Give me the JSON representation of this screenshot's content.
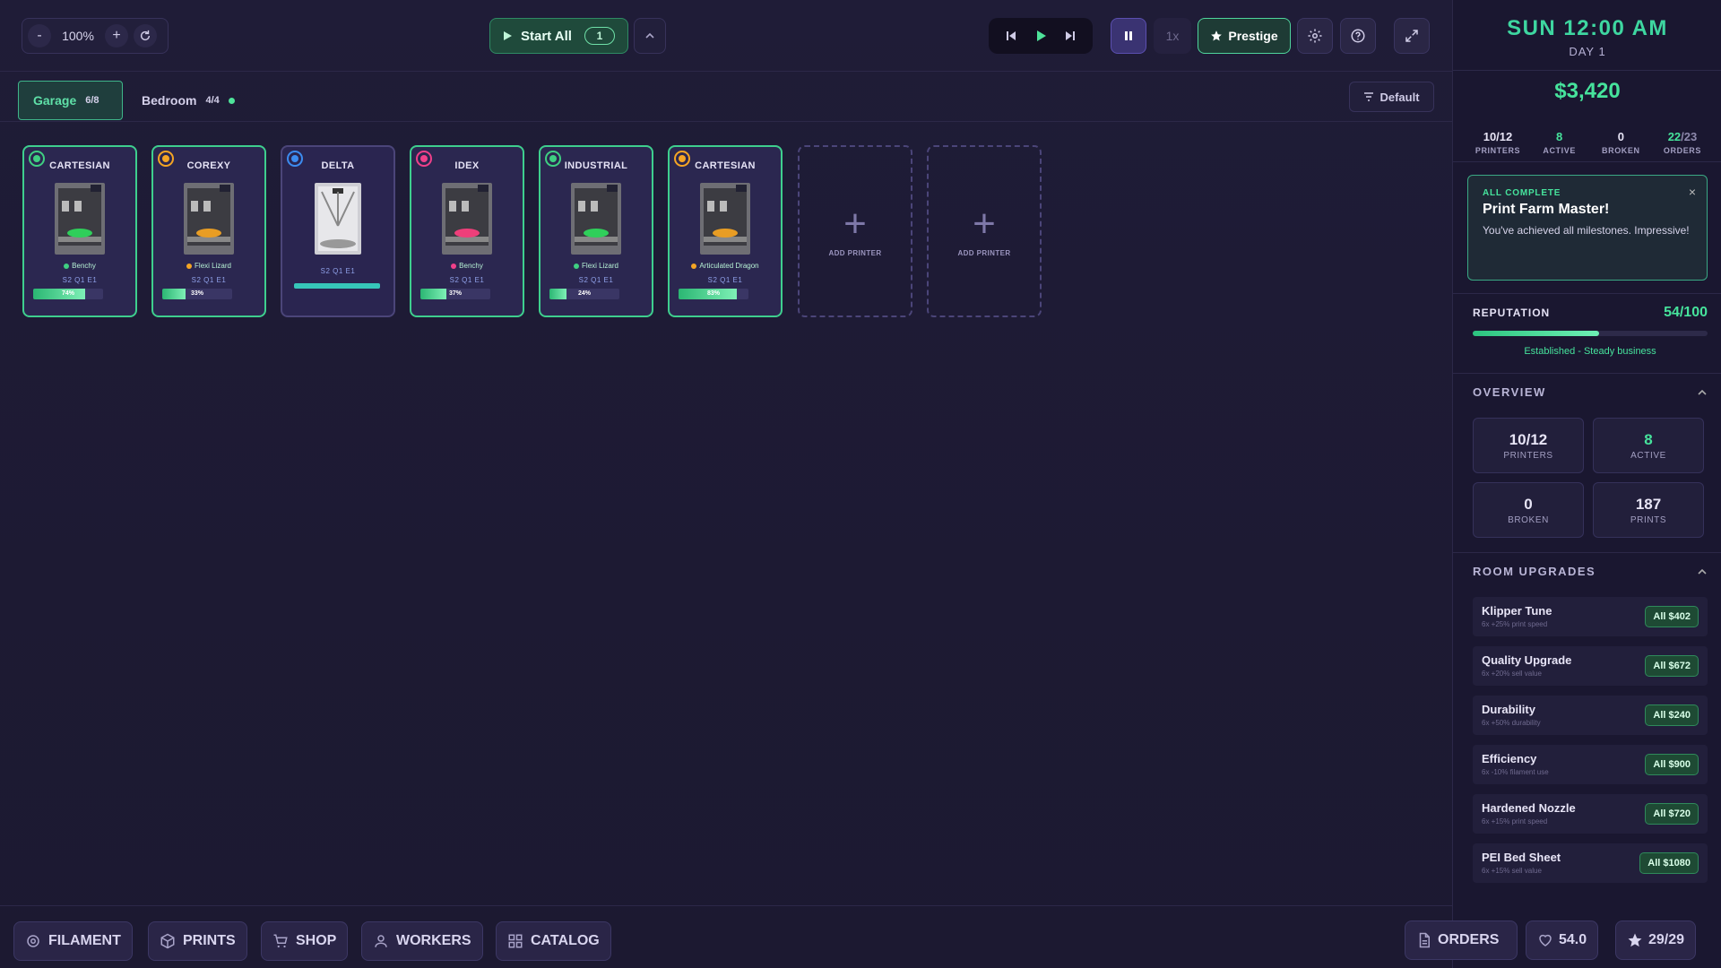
{
  "toolbar": {
    "zoom_minus": "-",
    "zoom_value": "100%",
    "zoom_plus": "+",
    "start_all_label": "Start All",
    "start_all_count": "1",
    "speed_label": "1x",
    "prestige_label": "Prestige"
  },
  "rooms": [
    {
      "name": "Garage",
      "count": "6/8"
    },
    {
      "name": "Bedroom",
      "count": "4/4"
    }
  ],
  "sort_label": "Default",
  "printers": [
    {
      "type": "CARTESIAN",
      "status_color": "#3fcf82",
      "model": "Benchy",
      "model_color": "#3fcf82",
      "stats": "S2 Q1 E1",
      "progress": 74,
      "progress_label": "74%",
      "print_color": "#2fcf5a"
    },
    {
      "type": "COREXY",
      "status_color": "#f5a524",
      "model": "Flexi Lizard",
      "model_color": "#f5a524",
      "stats": "S2 Q1 E1",
      "progress": 33,
      "progress_label": "33%",
      "print_color": "#e89d24"
    },
    {
      "type": "DELTA",
      "status_color": "#3c8cf0",
      "model": "",
      "model_color": "#3c8cf0",
      "stats": "S2 Q1 E1",
      "progress": 100,
      "progress_label": "",
      "print_color": ""
    },
    {
      "type": "IDEX",
      "status_color": "#f0408a",
      "model": "Benchy",
      "model_color": "#f0408a",
      "stats": "S2 Q1 E1",
      "progress": 37,
      "progress_label": "37%",
      "print_color": "#ee3f7a"
    },
    {
      "type": "INDUSTRIAL",
      "status_color": "#3fcf82",
      "model": "Flexi Lizard",
      "model_color": "#3fcf82",
      "stats": "S2 Q1 E1",
      "progress": 24,
      "progress_label": "24%",
      "print_color": "#2fcf5a"
    },
    {
      "type": "CARTESIAN",
      "status_color": "#f5a524",
      "model": "Articulated Dragon",
      "model_color": "#f5a524",
      "stats": "S2 Q1 E1",
      "progress": 83,
      "progress_label": "83%",
      "print_color": "#e89d24"
    }
  ],
  "add_printer_label": "ADD PRINTER",
  "bottom_nav": [
    {
      "label": "FILAMENT",
      "icon": "filament-icon"
    },
    {
      "label": "PRINTS",
      "icon": "box-icon"
    },
    {
      "label": "SHOP",
      "icon": "cart-icon"
    },
    {
      "label": "WORKERS",
      "icon": "person-icon"
    },
    {
      "label": "CATALOG",
      "icon": "grid-icon"
    }
  ],
  "sidebar": {
    "clock": "SUN 12:00 AM",
    "day": "DAY 1",
    "money": "$3,420",
    "stats": [
      {
        "value": "10/12",
        "label": "PRINTERS",
        "color": "#e7e4f5"
      },
      {
        "value": "8",
        "label": "ACTIVE",
        "color": "#46e39c"
      },
      {
        "value": "0",
        "label": "BROKEN",
        "color": "#e7e4f5"
      },
      {
        "value_a": "22",
        "value_b": "/23",
        "label": "ORDERS",
        "color": "#46e39c"
      }
    ],
    "achievement": {
      "label": "ALL COMPLETE",
      "title": "Print Farm Master!",
      "desc": "You've achieved all milestones. Impressive!",
      "close": "×"
    },
    "reputation": {
      "label": "REPUTATION",
      "value": "54/100",
      "fraction": 0.54,
      "note": "Established - Steady business"
    },
    "overview_title": "OVERVIEW",
    "overview": [
      {
        "value": "10/12",
        "label": "PRINTERS",
        "color": "#ffffff"
      },
      {
        "value": "8",
        "label": "ACTIVE",
        "color": "#46e39c"
      },
      {
        "value": "0",
        "label": "BROKEN",
        "color": "#ffffff"
      },
      {
        "value": "187",
        "label": "PRINTS",
        "color": "#ffffff"
      }
    ],
    "upgrades_title": "ROOM UPGRADES",
    "upgrades": [
      {
        "name": "Klipper Tune",
        "desc": "6x +25% print speed",
        "price": "All $402"
      },
      {
        "name": "Quality Upgrade",
        "desc": "6x +20% sell value",
        "price": "All $672"
      },
      {
        "name": "Durability",
        "desc": "6x +50% durability",
        "price": "All $240"
      },
      {
        "name": "Efficiency",
        "desc": "6x -10% filament use",
        "price": "All $900"
      },
      {
        "name": "Hardened Nozzle",
        "desc": "6x +15% print speed",
        "price": "All $720"
      },
      {
        "name": "PEI Bed Sheet",
        "desc": "6x +15% sell value",
        "price": "All $1080"
      }
    ],
    "orders_label": "ORDERS",
    "hearts_value": "54.0",
    "stars_value": "29/29"
  }
}
